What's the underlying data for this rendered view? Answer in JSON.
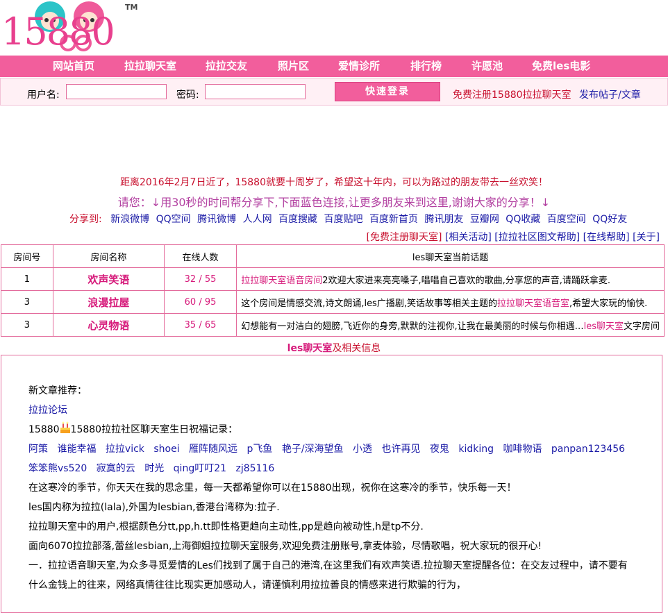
{
  "logo": {
    "text": "15880",
    "tm": "TM"
  },
  "nav": [
    "网站首页",
    "拉拉聊天室",
    "拉拉交友",
    "照片区",
    "爱情诊所",
    "排行榜",
    "许愿池",
    "免费les电影"
  ],
  "login": {
    "username_label": "用户名:",
    "password_label": "密码:",
    "submit_label": "快速登录",
    "register_link": "免费注册15880拉拉聊天室",
    "post_link": "发布帖子/文章"
  },
  "notices": {
    "line1": "距离2016年2月7日近了，15880就要十周岁了，希望这十年内，可以为路过的朋友带去一丝欢笑！",
    "line2": "请您：↓用30秒的时间帮分享下,下面蓝色连接,让更多朋友来到这里,谢谢大家的分享！↓"
  },
  "share": {
    "label": "分享到:",
    "targets": [
      "新浪微博",
      "QQ空间",
      "腾讯微博",
      "人人网",
      "百度搜藏",
      "百度贴吧",
      "百度新首页",
      "腾讯朋友",
      "豆瓣网",
      "QQ收藏",
      "百度空间",
      "QQ好友"
    ]
  },
  "links": [
    "[免费注册聊天室]",
    "[相关活动]",
    "[拉拉社区图文帮助]",
    "[在线帮助]",
    "[关于]"
  ],
  "table": {
    "headers": [
      "房间号",
      "房间名称",
      "在线人数",
      "les聊天室当前话题"
    ],
    "rows": [
      {
        "num": "1",
        "name": "欢声笑语",
        "online": "32 / 55",
        "topic_hl": "拉拉聊天室语音房间",
        "topic": "2欢迎大家进来亮亮嗓子,唱唱自己喜欢的歌曲,分享您的声音,请踊跃拿麦."
      },
      {
        "num": "3",
        "name": "浪漫拉屋",
        "online": "60 / 95",
        "topic_pre": "这个房间是情感交流,诗文朗诵,les广播剧,笑话故事等相关主题的",
        "topic_hl": "拉拉聊天室语音室",
        "topic": ",希望大家玩的愉快."
      },
      {
        "num": "3",
        "name": "心灵物语",
        "online": "35 / 65",
        "topic_pre": "幻想能有一对洁白的翅膀,飞近你的身旁,默默的注视你,让我在最美丽的时候与你相遇…",
        "topic_hl": "les聊天室",
        "topic": "文字房间"
      }
    ]
  },
  "les_info": {
    "hl": "les聊天室",
    "rest": "及相关信息"
  },
  "content": {
    "new_articles_label": "新文章推荐：",
    "forum_link": "拉拉论坛",
    "birthday_prefix": "15880",
    "birthday_text": "15880拉拉社区聊天室生日祝福记录：",
    "friends": [
      "阿策",
      "谁能幸福",
      "拉拉vick",
      "shoei",
      "雁阵随风远",
      "p飞鱼",
      "艳子/深海望鱼",
      "小透",
      "也许再见",
      "夜鬼",
      "kidking",
      "咖啡物语",
      "panpan123456",
      "笨笨熊vs520",
      "寂寞的云",
      "时光",
      "qing叮叮21",
      "zj85116"
    ],
    "p1": "在这寒冷的季节，你天天在我的思念里，每一天都希望你可以在15880出现，祝你在这寒冷的季节，快乐每一天！",
    "p2": "les国内称为拉拉(lala),外国为lesbian,香港台湾称为:拉子.",
    "p3": "拉拉聊天室中的用户,根据颜色分tt,pp,h.tt即性格更趋向主动性,pp是趋向被动性,h是tp不分.",
    "p4": "面向6070拉拉部落,蕾丝lesbian,上海御姐拉拉聊天室服务,欢迎免费注册账号,拿麦体验，尽情歌唱，祝大家玩的很开心!",
    "p5": "一．拉拉语音聊天室,为众多寻觅爱情的Les们找到了属于自己的港湾,在这里我们有欢声笑语.拉拉聊天室提醒各位：在交友过程中，请不要有什么金钱上的往来，网络真情往往比现实更加感动人，请谨慎利用拉拉善良的情感来进行欺骗的行为，"
  },
  "colors": {
    "brand_pink": "#f25e9c",
    "topic_pink": "#d6197a",
    "notice_red": "#c8102e",
    "link_blue": "#1a1aa6"
  }
}
